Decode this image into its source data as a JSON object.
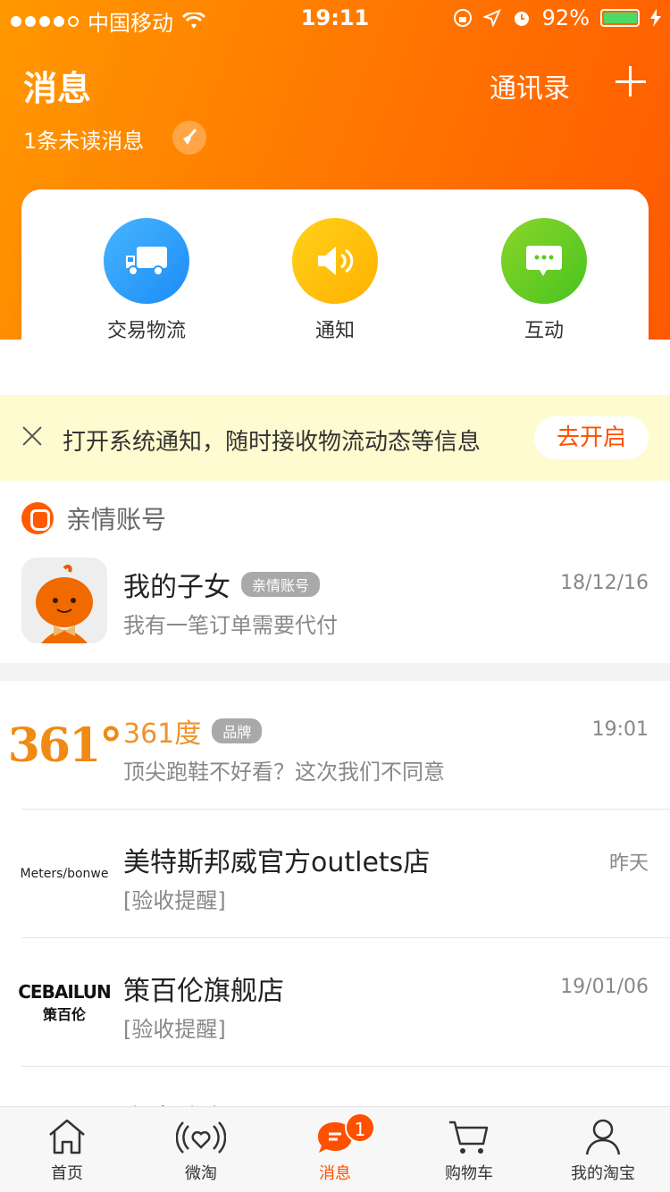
{
  "status_bar": {
    "carrier": "中国移动",
    "time": "19:11",
    "battery": "92%"
  },
  "header": {
    "title": "消息",
    "contacts": "通讯录",
    "unread": "1条未读消息"
  },
  "categories": [
    {
      "label": "交易物流",
      "icon": "truck-icon",
      "color": "#2a9cf8"
    },
    {
      "label": "通知",
      "icon": "speaker-icon",
      "color": "#ffc000"
    },
    {
      "label": "互动",
      "icon": "chat-icon",
      "color": "#5fc822"
    }
  ],
  "banner": {
    "text": "打开系统通知，随时接收物流动态等信息",
    "button": "去开启"
  },
  "family": {
    "title": "亲情账号",
    "name": "我的子女",
    "tag": "亲情账号",
    "message": "我有一笔订单需要代付",
    "time": "18/12/16"
  },
  "messages": [
    {
      "logo": "361°",
      "name": "361度",
      "tag": "品牌",
      "message": "顶尖跑鞋不好看？这次我们不同意",
      "time": "19:01"
    },
    {
      "logo": "Meters/bonwe",
      "name": "美特斯邦威官方outlets店",
      "message": "[验收提醒]",
      "time": "昨天"
    },
    {
      "logo": "CEBAILUN",
      "logo_sub": "策百伦",
      "name": "策百伦旗舰店",
      "message": "[验收提醒]",
      "time": "19/01/06"
    },
    {
      "name": "淘宝头条",
      "message": "",
      "time": ""
    }
  ],
  "tabs": [
    {
      "label": "首页",
      "icon": "home-icon"
    },
    {
      "label": "微淘",
      "icon": "heart-wave-icon"
    },
    {
      "label": "消息",
      "icon": "message-icon",
      "badge": "1"
    },
    {
      "label": "购物车",
      "icon": "cart-icon"
    },
    {
      "label": "我的淘宝",
      "icon": "profile-icon"
    }
  ],
  "colors": {
    "accent": "#ff5000",
    "header_start": "#ff9800",
    "header_end": "#ff5a00"
  }
}
